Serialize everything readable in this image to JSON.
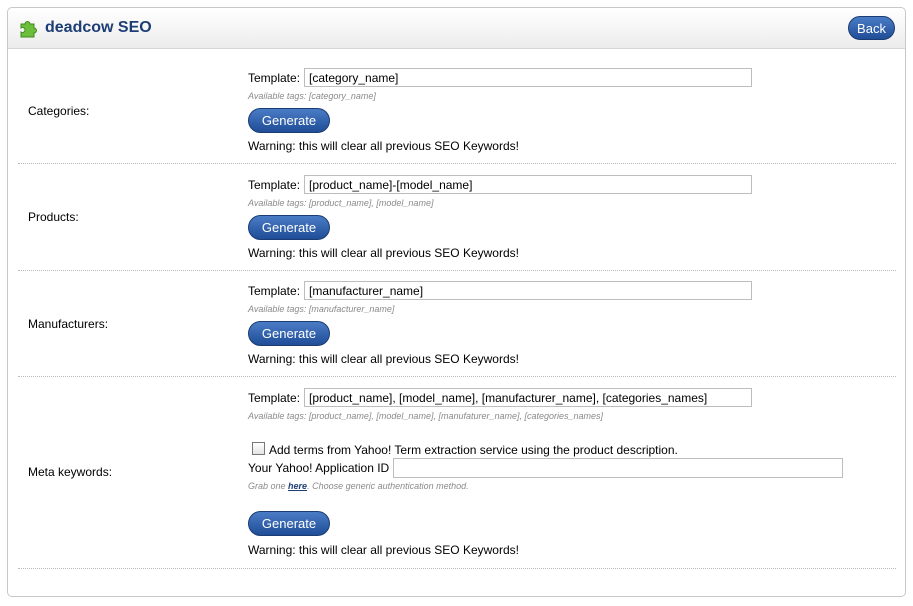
{
  "header": {
    "title": "deadcow SEO",
    "back_label": "Back"
  },
  "common": {
    "template_label": "Template:",
    "generate_label": "Generate",
    "warning": "Warning: this will clear all previous SEO Keywords!"
  },
  "sections": {
    "categories": {
      "label": "Categories:",
      "template_value": "[category_name]",
      "available": "Available tags: [category_name]"
    },
    "products": {
      "label": "Products:",
      "template_value": "[product_name]-[model_name]",
      "available": "Available tags: [product_name], [model_name]"
    },
    "manufacturers": {
      "label": "Manufacturers:",
      "template_value": "[manufacturer_name]",
      "available": "Available tags: [manufacturer_name]"
    },
    "meta": {
      "label": "Meta keywords:",
      "template_value": "[product_name], [model_name], [manufacturer_name], [categories_names]",
      "available": "Available tags: [product_name], [model_name], [manufaturer_name], [categories_names]",
      "checkbox_label": "Add terms from Yahoo! Term extraction service using the product description.",
      "yahoo_label": "Your Yahoo! Application ID",
      "yahoo_value": "",
      "grab_prefix": "Grab one",
      "grab_link": "here",
      "grab_suffix": ". Choose generic authentication method."
    }
  },
  "colors": {
    "brand": "#1d3e75",
    "button_top": "#4a7cc5",
    "button_bottom": "#1f4d97"
  }
}
